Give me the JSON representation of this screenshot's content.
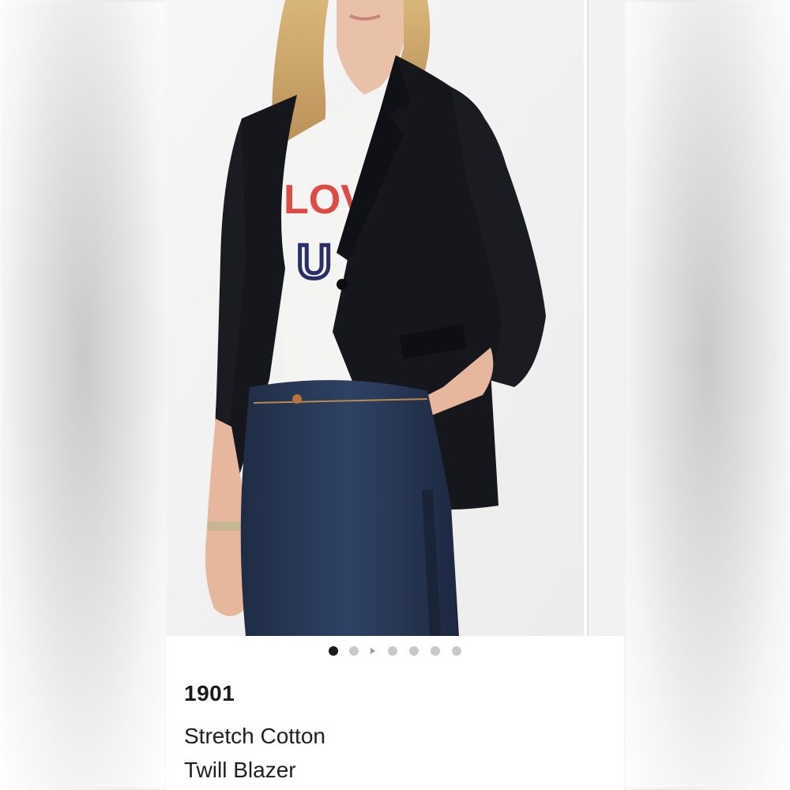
{
  "product": {
    "brand": "1901",
    "name_line_1": "Stretch Cotton",
    "name_line_2": "Twill Blazer"
  },
  "gallery": {
    "image_count": 6,
    "active_index": 0,
    "main_image": {
      "tshirt_text_top": "LOV",
      "tshirt_text_bottom": "U"
    }
  },
  "colors": {
    "blazer": "#16171c",
    "tshirt": "#f4f4f2",
    "jeans": "#25344f",
    "tshirt_print_red": "#e04a44",
    "tshirt_print_navy": "#2b2f66",
    "dot_active": "#1c1c1c",
    "dot_inactive": "#c8c8c8"
  },
  "icons": {
    "slideshow": "play-arrow-icon"
  }
}
